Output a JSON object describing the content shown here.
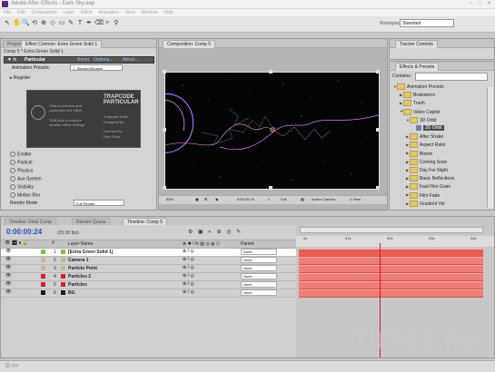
{
  "window": {
    "title": "Adobe After Effects - Dark Sky.aep",
    "controls": [
      "–",
      "□",
      "✕"
    ]
  },
  "menu": [
    "File",
    "Edit",
    "Composition",
    "Layer",
    "Effect",
    "Animation",
    "View",
    "Window",
    "Help"
  ],
  "toolbar": {
    "tools": [
      "↖",
      "✋",
      "🔍",
      "⟲",
      "⊕",
      "◇",
      "▭",
      "✎",
      "T",
      "✒",
      "⌫",
      "✧",
      "⚲"
    ],
    "workspace_label": "Workspace:",
    "workspace_value": "Standard"
  },
  "effect_controls": {
    "tab_project": "Project",
    "tab": "Effect Controls: Extra Green Solid 1",
    "layer_path": "Comp 5 * Extra Green Solid 1",
    "effect_name": "Particular",
    "reset_link": "Reset",
    "options_link": "Options...",
    "about_link": "About...",
    "animation_presets_label": "Animation Presets:",
    "animation_presets_value": "1_StarburstSparks",
    "register_label": "Register",
    "promo_line1": "Click to preview and",
    "promo_line2": "customize this effect",
    "promo_line3": "Shift-click to explore",
    "promo_line4": "another effect settings",
    "promo_logo": "TRAPCODE PARTICULAR",
    "promo_sub1": "Trapcode Suite",
    "promo_sub2": "Designed by",
    "promo_sub3": "Licensed to",
    "promo_sub4": "Red Giant",
    "sections": [
      "Emitter",
      "Particle",
      "Physics",
      "Aux System",
      "Visibility",
      "Motion Blur"
    ],
    "render_mode_label": "Render Mode",
    "render_mode_value": "Full Render"
  },
  "composition": {
    "tab": "Composition: Comp 5",
    "zoom": "50%",
    "timecode": "0:00:00:24",
    "resolution": "Full",
    "camera": "Active Camera",
    "views": "1 View"
  },
  "tracker": {
    "tab": "Tracker Controls"
  },
  "effects_presets": {
    "tab": "Effects & Presets",
    "contains_label": "Contains:",
    "items": [
      {
        "label": "Animation Presets",
        "depth": 0,
        "open": true,
        "type": "folder"
      },
      {
        "label": "Brainstorm",
        "depth": 1,
        "open": false,
        "type": "folder"
      },
      {
        "label": "Trash",
        "depth": 1,
        "open": false,
        "type": "folder"
      },
      {
        "label": "Video Copilot",
        "depth": 1,
        "open": true,
        "type": "folder"
      },
      {
        "label": "3D Orbit",
        "depth": 2,
        "open": true,
        "type": "folder"
      },
      {
        "label": "3D Orbit",
        "depth": 3,
        "open": false,
        "type": "effect",
        "selected": true
      },
      {
        "label": "After Shake",
        "depth": 2,
        "open": false,
        "type": "folder"
      },
      {
        "label": "Aspect Ratio",
        "depth": 2,
        "open": false,
        "type": "folder"
      },
      {
        "label": "Bloom",
        "depth": 2,
        "open": false,
        "type": "folder"
      },
      {
        "label": "Coming Soon",
        "depth": 2,
        "open": false,
        "type": "folder"
      },
      {
        "label": "Day For Night",
        "depth": 2,
        "open": false,
        "type": "folder"
      },
      {
        "label": "Basic Reflections",
        "depth": 2,
        "open": false,
        "type": "folder"
      },
      {
        "label": "Fast Film Grain",
        "depth": 2,
        "open": false,
        "type": "folder"
      },
      {
        "label": "Film Fade",
        "depth": 2,
        "open": false,
        "type": "folder"
      },
      {
        "label": "Gradient Vol",
        "depth": 2,
        "open": false,
        "type": "folder"
      }
    ]
  },
  "timeline": {
    "tabs": [
      "Timeline: Final Comp",
      "Render Queue",
      "Timeline: Comp 5"
    ],
    "timecode": "0:00:00:24",
    "fps": "(25.00 fps)",
    "col_layer_name": "Layer Name",
    "col_parent": "Parent",
    "ruler_ticks": [
      "0s",
      "01s",
      "02s",
      "03s",
      "04s"
    ],
    "layers": [
      {
        "num": "1",
        "name": "[Extra Green Solid 1]",
        "color": "#7ec03c",
        "parent": "None",
        "selected": true
      },
      {
        "num": "2",
        "name": "Camera 1",
        "color": "#c8b4a0",
        "parent": "None",
        "selected": false
      },
      {
        "num": "3",
        "name": "Particle Point",
        "color": "#c8b4a0",
        "parent": "None",
        "selected": false
      },
      {
        "num": "4",
        "name": "Particles 2",
        "color": "#d41f2a",
        "parent": "None",
        "selected": false
      },
      {
        "num": "5",
        "name": "Particles",
        "color": "#d41f2a",
        "parent": "None",
        "selected": false
      },
      {
        "num": "6",
        "name": "BG",
        "color": "#1c1c1c",
        "parent": "None",
        "selected": false
      }
    ],
    "cti_color": "#e11122"
  },
  "watermark": {
    "text": "TUTES.RU",
    "sub": "ВСЁ ЧТО НУЖНО ДЛЯ ДИЗАЙНА"
  }
}
